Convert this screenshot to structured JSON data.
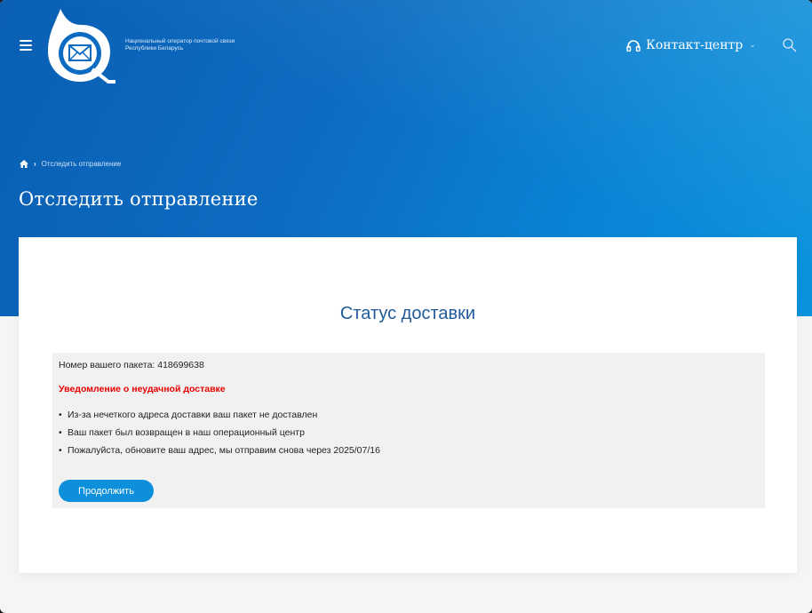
{
  "header": {
    "org_name_line1": "Национальный оператор почтовой связи",
    "org_name_line2": "Республики Беларусь",
    "contact_label": "Контакт-центр",
    "menu_icon": "hamburger-icon",
    "search_icon": "search-icon",
    "contact_icon": "headphones-icon"
  },
  "breadcrumb": {
    "home_icon": "home-icon",
    "current": "Отследить отправление"
  },
  "page": {
    "title": "Отследить отправление"
  },
  "status": {
    "heading": "Статус доставки",
    "package_label": "Номер вашего пакета: 418699638",
    "notice": "Уведомление о неудачной доставке",
    "items": [
      "Из-за нечеткого адреса доставки ваш пакет не доставлен",
      "Ваш пакет был возвращен в наш операционный центр",
      "Пожалуйста, обновите ваш адрес, мы отправим снова через 2025/07/16"
    ],
    "continue_label": "Продолжить"
  },
  "colors": {
    "hero_blue": "#0c6cc2",
    "heading_blue": "#1f5a9a",
    "notice_red": "#e60000",
    "button_blue": "#0e8fdc"
  }
}
